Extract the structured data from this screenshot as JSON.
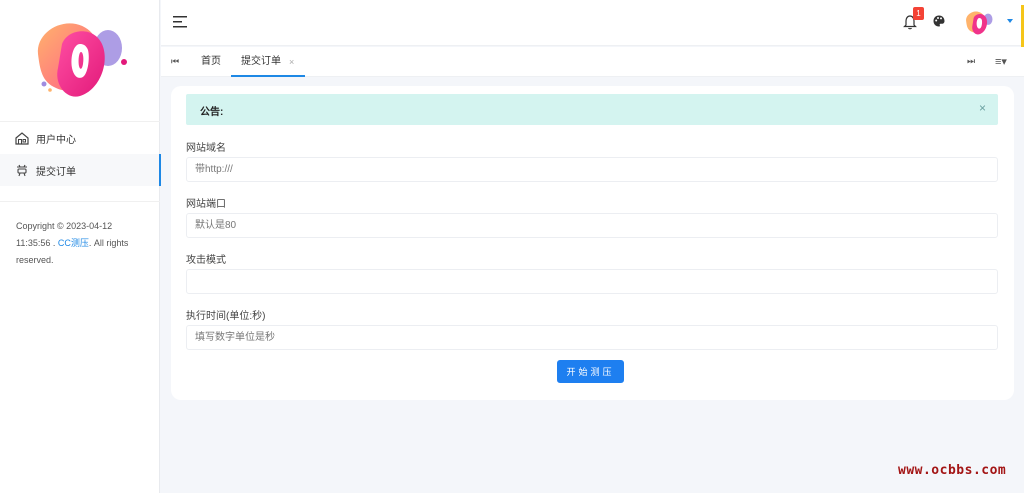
{
  "sidebar": {
    "items": [
      {
        "label": "用户中心",
        "icon": "home-icon"
      },
      {
        "label": "提交订单",
        "icon": "order-icon",
        "active": true
      }
    ],
    "copyright_prefix": "Copyright © 2023-04-12 11:35:56 . ",
    "copyright_link": "CC测压",
    "copyright_suffix": ". All rights reserved."
  },
  "topbar": {
    "notification_count": "1"
  },
  "tabs": {
    "home_label": "首页",
    "order_label": "提交订单",
    "close_glyph": "×"
  },
  "notice": {
    "title": "公告:",
    "close_glyph": "×"
  },
  "form": {
    "domain_label": "网站域名",
    "domain_placeholder": "带http:///",
    "port_label": "网站端口",
    "port_placeholder": "默认是80",
    "mode_label": "攻击模式",
    "mode_placeholder": "",
    "time_label": "执行时间(单位:秒)",
    "time_placeholder": "填写数字单位是秒",
    "submit_label": "开始测压"
  },
  "watermark": "www.ocbbs.com",
  "colors": {
    "accent": "#1e88e5",
    "notice_bg": "#d4f4f0",
    "badge": "#f44336",
    "watermark": "#a31515"
  }
}
